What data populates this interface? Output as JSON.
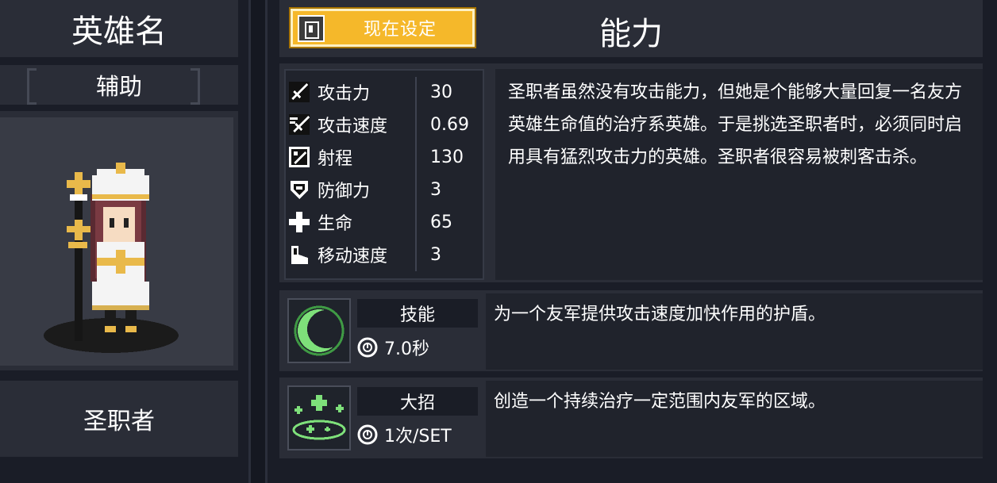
{
  "hero_panel": {
    "header": "英雄名",
    "role": "辅助",
    "name": "圣职者"
  },
  "top_bar": {
    "set_button_label": "现在设定",
    "section_title": "能力"
  },
  "stats": [
    {
      "icon": "sword-icon",
      "label": "攻击力",
      "value": "30"
    },
    {
      "icon": "speed-sword-icon",
      "label": "攻击速度",
      "value": "0.69"
    },
    {
      "icon": "range-icon",
      "label": "射程",
      "value": "130"
    },
    {
      "icon": "shield-icon",
      "label": "防御力",
      "value": "3"
    },
    {
      "icon": "health-cross-icon",
      "label": "生命",
      "value": "65"
    },
    {
      "icon": "boot-icon",
      "label": "移动速度",
      "value": "3"
    }
  ],
  "description": "圣职者虽然没有攻击能力，但她是个能够大量回复一名友方英雄生命值的治疗系英雄。于是挑选圣职者时，必须同时启用具有猛烈攻击力的英雄。圣职者很容易被刺客击杀。",
  "skill": {
    "title": "技能",
    "cooldown": "7.0秒",
    "description": "为一个友军提供攻击速度加快作用的护盾。",
    "icon": "crescent-shield-icon"
  },
  "ultimate": {
    "title": "大招",
    "cooldown": "1次/SET",
    "description": "创造一个持续治疗一定范围内友军的区域。",
    "icon": "healing-zone-icon"
  },
  "colors": {
    "background": "#151821",
    "panel": "#2a2d37",
    "button_gold": "#f5b82a",
    "skill_green": "#7ee07a"
  }
}
